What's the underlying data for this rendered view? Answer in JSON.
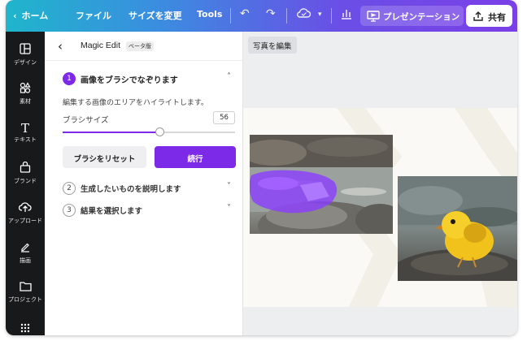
{
  "topbar": {
    "home_label": "ホーム",
    "file_label": "ファイル",
    "resize_label": "サイズを変更",
    "tools_label": "Tools",
    "present_label": "プレゼンテーション",
    "share_label": "共有"
  },
  "rail": {
    "items": [
      {
        "label": "デザイン",
        "icon": "layout-icon"
      },
      {
        "label": "素材",
        "icon": "elements-icon"
      },
      {
        "label": "テキスト",
        "icon": "text-icon"
      },
      {
        "label": "ブランド",
        "icon": "brand-icon"
      },
      {
        "label": "アップロード",
        "icon": "upload-icon"
      },
      {
        "label": "描画",
        "icon": "draw-icon"
      },
      {
        "label": "プロジェクト",
        "icon": "folder-icon"
      }
    ]
  },
  "panel": {
    "title": "Magic Edit",
    "beta_badge": "ベータ版",
    "step1": {
      "num": "1",
      "title": "画像をブラシでなぞります",
      "description": "編集する画像のエリアをハイライトします。"
    },
    "brush_size_label": "ブラシサイズ",
    "brush_size_value": "56",
    "brush_size_fraction": 0.56,
    "reset_label": "ブラシをリセット",
    "continue_label": "続行",
    "step2": {
      "num": "2",
      "title": "生成したいものを説明します"
    },
    "step3": {
      "num": "3",
      "title": "結果を選択します"
    }
  },
  "canvas": {
    "edit_photo_label": "写真を編集"
  },
  "colors": {
    "accent": "#7d2ae8",
    "rail_bg": "#18191b",
    "brush_overlay": "#8b3dff"
  }
}
